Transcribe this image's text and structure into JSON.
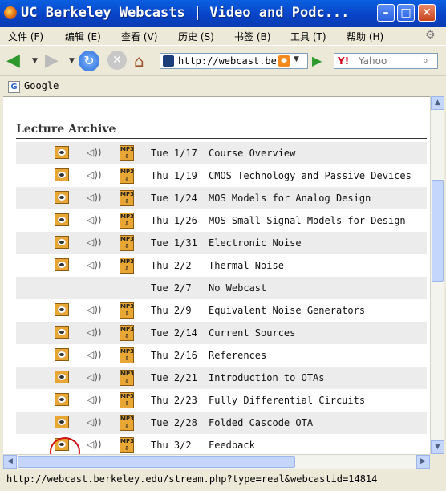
{
  "window": {
    "title": "UC Berkeley Webcasts | Video and Podc...",
    "min": "–",
    "max": "□",
    "close": "✕"
  },
  "menu": [
    {
      "label": "文件 (F)"
    },
    {
      "label": "编辑 (E)"
    },
    {
      "label": "查看 (V)"
    },
    {
      "label": "历史 (S)"
    },
    {
      "label": "书签 (B)"
    },
    {
      "label": "工具 (T)"
    },
    {
      "label": "帮助 (H)"
    }
  ],
  "nav": {
    "url": "http://webcast.be",
    "search_placeholder": "Yahoo",
    "search_engine": "Y!"
  },
  "bookmarks": {
    "google": "Google",
    "google_icon": "G"
  },
  "page": {
    "heading": "Lecture Archive",
    "mp3_label": "MP3",
    "lectures": [
      {
        "date": "Tue 1/17",
        "topic": "Course Overview",
        "media": true
      },
      {
        "date": "Thu 1/19",
        "topic": "CMOS Technology and Passive Devices",
        "media": true
      },
      {
        "date": "Tue 1/24",
        "topic": "MOS Models for Analog Design",
        "media": true
      },
      {
        "date": "Thu 1/26",
        "topic": "MOS Small-Signal Models for Design",
        "media": true
      },
      {
        "date": "Tue 1/31",
        "topic": "Electronic Noise",
        "media": true
      },
      {
        "date": "Thu 2/2",
        "topic": "Thermal Noise",
        "media": true
      },
      {
        "date": "Tue 2/7",
        "topic": "No Webcast",
        "media": false
      },
      {
        "date": "Thu 2/9",
        "topic": "Equivalent Noise Generators",
        "media": true
      },
      {
        "date": "Tue 2/14",
        "topic": "Current Sources",
        "media": true
      },
      {
        "date": "Thu 2/16",
        "topic": "References",
        "media": true
      },
      {
        "date": "Tue 2/21",
        "topic": "Introduction to OTAs",
        "media": true
      },
      {
        "date": "Thu 2/23",
        "topic": "Fully Differential Circuits",
        "media": true
      },
      {
        "date": "Tue 2/28",
        "topic": "Folded Cascode OTA",
        "media": true
      },
      {
        "date": "Thu 3/2",
        "topic": "Feedback",
        "media": true
      }
    ]
  },
  "status": {
    "text": "http://webcast.berkeley.edu/stream.php?type=real&webcastid=14814"
  },
  "colors": {
    "titlebar": "#0a5fe0",
    "icon_orange": "#e8a634",
    "annotation_red": "#d01010"
  }
}
